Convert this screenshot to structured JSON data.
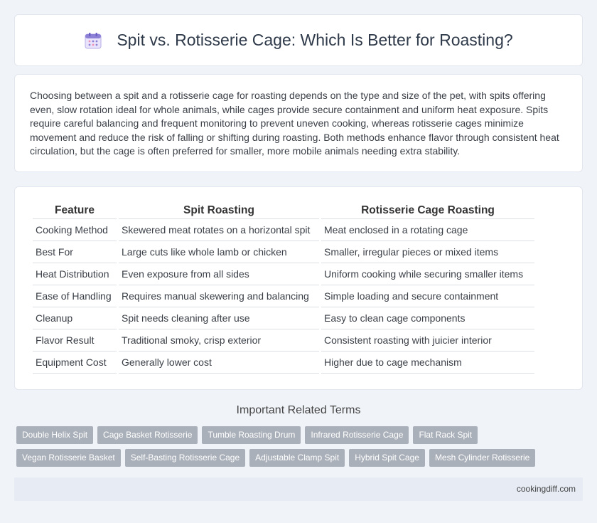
{
  "header": {
    "title": "Spit vs. Rotisserie Cage: Which Is Better for Roasting?",
    "icon": "calendar-icon"
  },
  "intro": {
    "text": "Choosing between a spit and a rotisserie cage for roasting depends on the type and size of the pet, with spits offering even, slow rotation ideal for whole animals, while cages provide secure containment and uniform heat exposure. Spits require careful balancing and frequent monitoring to prevent uneven cooking, whereas rotisserie cages minimize movement and reduce the risk of falling or shifting during roasting. Both methods enhance flavor through consistent heat circulation, but the cage is often preferred for smaller, more mobile animals needing extra stability."
  },
  "table": {
    "headers": [
      "Feature",
      "Spit Roasting",
      "Rotisserie Cage Roasting"
    ],
    "rows": [
      [
        "Cooking Method",
        "Skewered meat rotates on a horizontal spit",
        "Meat enclosed in a rotating cage"
      ],
      [
        "Best For",
        "Large cuts like whole lamb or chicken",
        "Smaller, irregular pieces or mixed items"
      ],
      [
        "Heat Distribution",
        "Even exposure from all sides",
        "Uniform cooking while securing smaller items"
      ],
      [
        "Ease of Handling",
        "Requires manual skewering and balancing",
        "Simple loading and secure containment"
      ],
      [
        "Cleanup",
        "Spit needs cleaning after use",
        "Easy to clean cage components"
      ],
      [
        "Flavor Result",
        "Traditional smoky, crisp exterior",
        "Consistent roasting with juicier interior"
      ],
      [
        "Equipment Cost",
        "Generally lower cost",
        "Higher due to cage mechanism"
      ]
    ]
  },
  "related": {
    "title": "Important Related Terms",
    "tags": [
      "Double Helix Spit",
      "Cage Basket Rotisserie",
      "Tumble Roasting Drum",
      "Infrared Rotisserie Cage",
      "Flat Rack Spit",
      "Vegan Rotisserie Basket",
      "Self-Basting Rotisserie Cage",
      "Adjustable Clamp Spit",
      "Hybrid Spit Cage",
      "Mesh Cylinder Rotisserie"
    ]
  },
  "footer": {
    "site": "cookingdiff.com"
  },
  "colors": {
    "background": "#f0f3f8",
    "tag_bg": "#aab0b9",
    "footer_bg": "#e6ebf4",
    "icon_accent": "#8b7fd6"
  }
}
